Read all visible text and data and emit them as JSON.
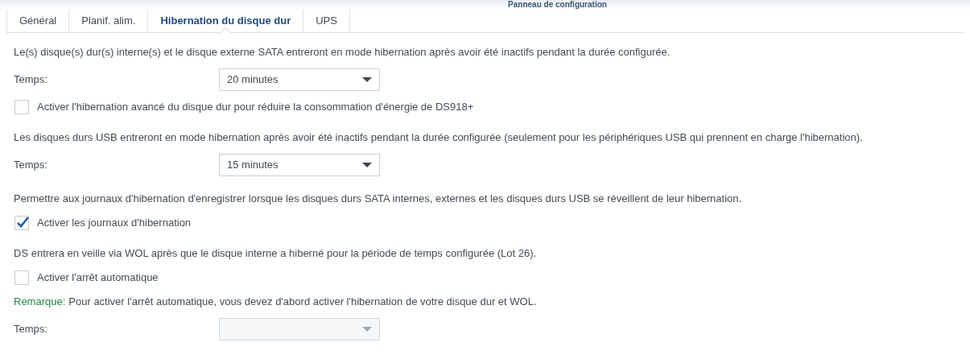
{
  "window": {
    "title": "Panneau de configuration"
  },
  "tabs": [
    {
      "label": "Général",
      "selected": false
    },
    {
      "label": "Planif. alim.",
      "selected": false
    },
    {
      "label": "Hibernation du disque dur",
      "selected": true
    },
    {
      "label": "UPS",
      "selected": false
    }
  ],
  "sections": [
    {
      "rows": [
        {
          "kind": "text",
          "text": "Le(s) disque(s) dur(s) interne(s) et le disque externe SATA entreront en mode hibernation après avoir été inactifs pendant la durée configurée."
        },
        {
          "kind": "select",
          "label": "Temps:",
          "value": "20 minutes",
          "disabled": false
        },
        {
          "kind": "checkbox",
          "label": "Activer l'hibernation avancé du disque dur pour réduire la consommation d'énergie de DS918+",
          "checked": false
        }
      ]
    },
    {
      "rows": [
        {
          "kind": "text",
          "text": "Les disques durs USB entreront en mode hibernation après avoir été inactifs pendant la durée configurée (seulement pour les périphériques USB qui prennent en charge l'hibernation)."
        },
        {
          "kind": "select",
          "label": "Temps:",
          "value": "15 minutes",
          "disabled": false
        }
      ]
    },
    {
      "rows": [
        {
          "kind": "text",
          "text": "Permettre aux journaux d'hibernation d'enregistrer lorsque les disques durs SATA internes, externes et les disques durs USB se réveillent de leur hibernation."
        },
        {
          "kind": "checkbox",
          "label": "Activer les journaux d'hibernation",
          "checked": true
        }
      ]
    },
    {
      "rows": [
        {
          "kind": "text",
          "text": "DS entrera en veille via WOL après que le disque interne a hiberné pour la période de temps configurée (Lot 26)."
        },
        {
          "kind": "checkbox",
          "label": "Activer l'arrêt automatique",
          "checked": false
        },
        {
          "kind": "note",
          "prefix": "Remarque:",
          "text": "Pour activer l'arrêt automatique, vous devez d'abord activer l'hibernation de votre disque dur et WOL."
        },
        {
          "kind": "select",
          "label": "Temps:",
          "value": "",
          "disabled": true
        }
      ]
    }
  ]
}
